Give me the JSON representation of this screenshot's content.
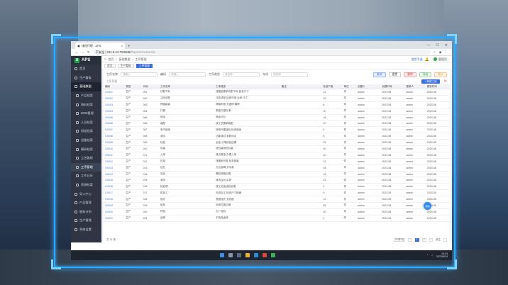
{
  "browser": {
    "tab_title": "排程代理 - APS",
    "url_warning": "不安全",
    "url": "121.9.44.70:8848/",
    "url_rest": "#/aps/schedule/list"
  },
  "app": {
    "logo_text": "APS",
    "sidebar": [
      {
        "label": "首页",
        "icon": "home-icon"
      },
      {
        "label": "生产看板",
        "icon": "monitor-icon"
      },
      {
        "label": "基础数据",
        "icon": "database-icon",
        "active": true
      },
      {
        "label": "产品档案",
        "icon": "product-icon",
        "sub": true
      },
      {
        "label": "物料档案",
        "icon": "material-icon",
        "sub": true
      },
      {
        "label": "BOM管理",
        "icon": "bom-icon",
        "sub": true
      },
      {
        "label": "人员档案",
        "icon": "person-icon",
        "sub": true
      },
      {
        "label": "班组档案",
        "icon": "team-icon",
        "sub": true
      },
      {
        "label": "设备档案",
        "icon": "equipment-icon",
        "sub": true
      },
      {
        "label": "模具档案",
        "icon": "mold-icon",
        "sub": true
      },
      {
        "label": "工艺路线",
        "icon": "route-icon",
        "sub": true
      },
      {
        "label": "工序管理",
        "icon": "process-icon",
        "sub": true,
        "highlight": true
      },
      {
        "label": "工作日历",
        "icon": "calendar-icon",
        "sub": true
      },
      {
        "label": "资源档案",
        "icon": "resource-icon",
        "sub": true
      },
      {
        "label": "导入中心",
        "icon": "import-icon"
      },
      {
        "label": "产品管理",
        "icon": "box-icon"
      },
      {
        "label": "物料计划",
        "icon": "plan-icon"
      },
      {
        "label": "生产管理",
        "icon": "factory-icon"
      },
      {
        "label": "系统设置",
        "icon": "settings-icon"
      }
    ],
    "topbar": {
      "crumbs": [
        "首页",
        "基础数据",
        "工序管理"
      ],
      "link": "使用手册",
      "user": "管理员"
    },
    "page_tabs": [
      {
        "label": "首页"
      },
      {
        "label": "生产看板"
      },
      {
        "label": "工序管理",
        "active": true
      }
    ],
    "filters": {
      "name_label": "工序名称",
      "name_placeholder": "请输入",
      "code_label": "编码",
      "code_placeholder": "请输入",
      "type_label": "工序类型",
      "type_placeholder": "请选择",
      "dept_label": "车间",
      "dept_placeholder": "请选择",
      "btn_search": "查询",
      "btn_reset": "重置",
      "btn_delete": "删除",
      "btn_export": "导出",
      "btn_import": "导入"
    },
    "toolbar": {
      "left": "工序列表",
      "add": "+ 新增工序"
    },
    "columns": [
      "编码",
      "类型",
      "代码",
      "工序名称",
      "工序描述",
      "备注",
      "标准产能",
      "单位",
      "创建人",
      "创建时间",
      "更新人",
      "更新时间"
    ],
    "rows": [
      [
        "GX001",
        "生产",
        "001",
        "切割下料",
        "按图纸要求切割下料 检查尺寸",
        "",
        "12",
        "件",
        "admin",
        "2023-08",
        "admin",
        "2023-08"
      ],
      [
        "GX002",
        "生产",
        "002",
        "冲压成型",
        "冲压成型 检查外观 毛刺 尺寸",
        "",
        "15",
        "件",
        "admin",
        "2023-08",
        "admin",
        "2023-08"
      ],
      [
        "GX003",
        "生产",
        "003",
        "焊接组装",
        "焊接牢固 无虚焊 漏焊",
        "",
        "8",
        "件",
        "admin",
        "2023-08",
        "admin",
        "2023-08"
      ],
      [
        "GX004",
        "生产",
        "004",
        "打磨",
        "表面打磨光滑",
        "",
        "20",
        "件",
        "admin",
        "2023-08",
        "admin",
        "2023-08"
      ],
      [
        "GX005",
        "生产",
        "005",
        "喷涂",
        "喷涂均匀",
        "",
        "18",
        "件",
        "admin",
        "2023-08",
        "admin",
        "2023-08"
      ],
      [
        "GX006",
        "生产",
        "006",
        "装配",
        "按工艺要求装配",
        "",
        "10",
        "件",
        "admin",
        "2023-08",
        "admin",
        "2023-08"
      ],
      [
        "GX007",
        "生产",
        "007",
        "电气接线",
        "按电气图接线 检查绝缘",
        "",
        "6",
        "件",
        "admin",
        "2023-08",
        "admin",
        "2023-08"
      ],
      [
        "GX008",
        "生产",
        "008",
        "调试",
        "功能调试 参数设定",
        "",
        "5",
        "件",
        "admin",
        "2023-08",
        "admin",
        "2023-08"
      ],
      [
        "GX009",
        "生产",
        "009",
        "检验",
        "全检 记录检验结果",
        "",
        "25",
        "件",
        "admin",
        "2023-08",
        "admin",
        "2023-08"
      ],
      [
        "GX010",
        "生产",
        "010",
        "包装",
        "按包装规范包装",
        "",
        "30",
        "件",
        "admin",
        "2023-08",
        "admin",
        "2023-08"
      ],
      [
        "GX011",
        "生产",
        "011",
        "入库",
        "清点数量 办理入库",
        "",
        "40",
        "件",
        "admin",
        "2023-08",
        "admin",
        "2023-08"
      ],
      [
        "GX012",
        "生产",
        "012",
        "折弯",
        "按图纸折弯 检查角度",
        "",
        "14",
        "件",
        "admin",
        "2023-08",
        "admin",
        "2023-08"
      ],
      [
        "GX013",
        "生产",
        "013",
        "钻孔",
        "孔位准确 去毛刺",
        "",
        "16",
        "件",
        "admin",
        "2023-08",
        "admin",
        "2023-08"
      ],
      [
        "GX014",
        "生产",
        "014",
        "攻丝",
        "螺纹规格正确",
        "",
        "16",
        "件",
        "admin",
        "2023-08",
        "admin",
        "2023-08"
      ],
      [
        "GX015",
        "生产",
        "015",
        "清洗",
        "清洗油污 杂质",
        "",
        "22",
        "件",
        "admin",
        "2023-08",
        "admin",
        "2023-08"
      ],
      [
        "GX016",
        "生产",
        "016",
        "热处理",
        "按工艺曲线热处理",
        "",
        "4",
        "件",
        "admin",
        "2023-08",
        "admin",
        "2023-08"
      ],
      [
        "GX017",
        "生产",
        "017",
        "机加工",
        "车铣加工 检查尺寸精度",
        "",
        "9",
        "件",
        "admin",
        "2023-08",
        "admin",
        "2023-08"
      ],
      [
        "GX018",
        "生产",
        "018",
        "抛光",
        "表面抛光 无划痕",
        "",
        "12",
        "件",
        "admin",
        "2023-08",
        "admin",
        "2023-08"
      ],
      [
        "GX019",
        "生产",
        "019",
        "贴标",
        "标签位置正确",
        "",
        "35",
        "件",
        "admin",
        "2023-08",
        "admin",
        "2023-08"
      ],
      [
        "GX020",
        "生产",
        "020",
        "终检",
        "出厂检验",
        "",
        "20",
        "件",
        "admin",
        "2023-08",
        "admin",
        "2023-08"
      ],
      [
        "GX021",
        "生产",
        "021",
        "返修",
        "不良品返修",
        "",
        "3",
        "件",
        "admin",
        "2023-08",
        "admin",
        "2023-08"
      ]
    ],
    "fab_label": "帮助",
    "pager": {
      "total": "共 21 条",
      "page_size": "20条/页",
      "pages": [
        "1",
        "2"
      ],
      "goto": "前往"
    }
  },
  "taskbar": {
    "time": "10:24",
    "date": "2023/8/24"
  },
  "colors": {
    "accent": "#3a6fd8",
    "sidebar": "#2f3542",
    "frame_glow": "#2fa8ff"
  }
}
